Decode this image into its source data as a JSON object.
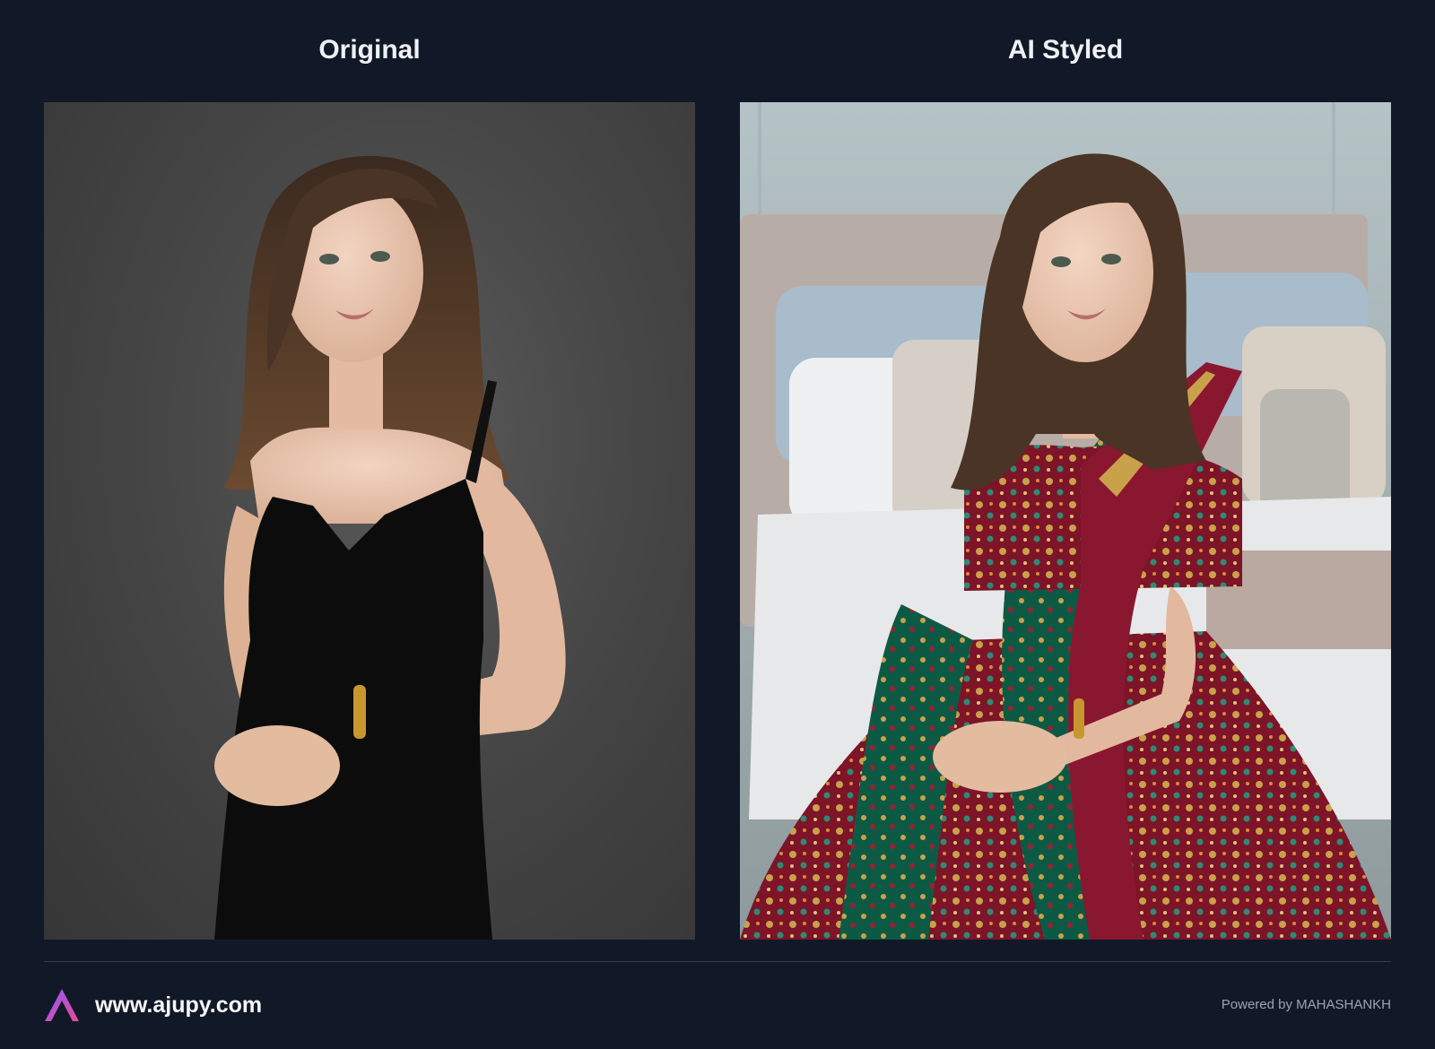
{
  "header": {
    "left_title": "Original",
    "right_title": "AI Styled"
  },
  "panels": {
    "left": {
      "subject": "model-in-black-dress"
    },
    "right": {
      "subject": "model-in-embroidered-lehenga"
    }
  },
  "footer": {
    "logo_icon": "ajupy-logo-icon",
    "url": "www.ajupy.com",
    "powered_by": "Powered by MAHASHANKH"
  },
  "colors": {
    "background": "#111827",
    "divider": "#334155",
    "logo_gradient_start": "#8b5cf6",
    "logo_gradient_end": "#ec4899",
    "muted_text": "#9ca3af"
  }
}
